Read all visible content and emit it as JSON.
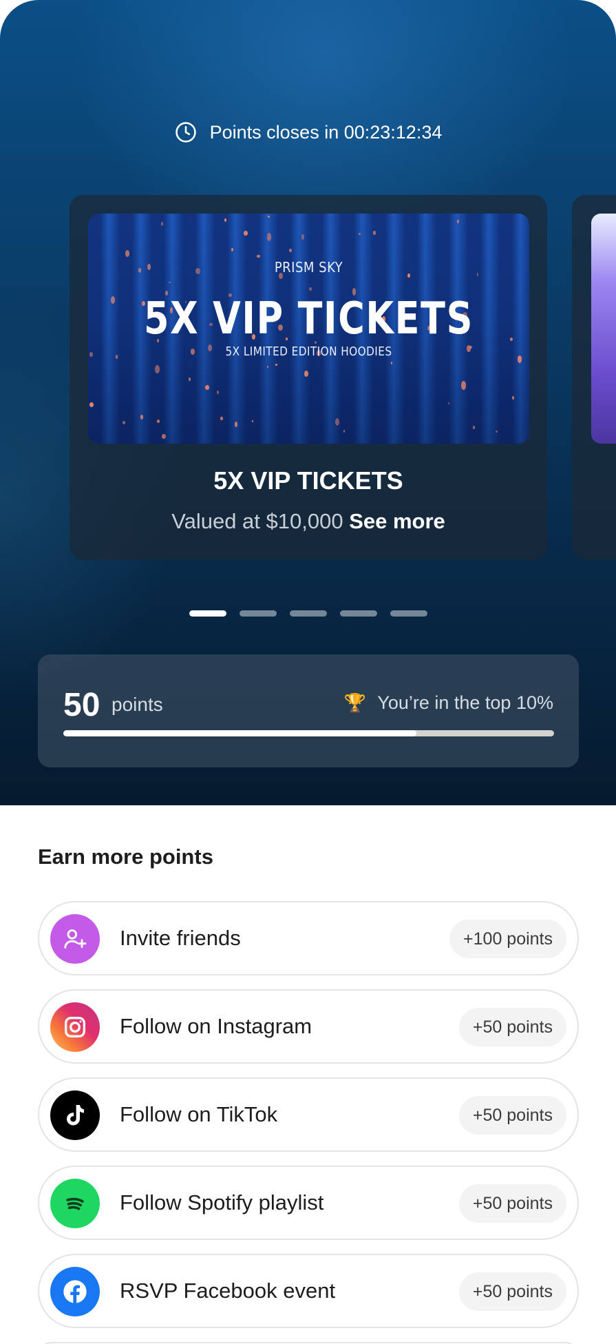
{
  "timer": {
    "text": "Points closes in 00:23:12:34",
    "icon": "clock-icon"
  },
  "prize_card": {
    "image": {
      "brand": "PRISM SKY",
      "title": "5X VIP TICKETS",
      "subtitle": "5X LIMITED EDITION HOODIES"
    },
    "title": "5X VIP TICKETS",
    "value_text": "Valued at $10,000",
    "see_more": "See more"
  },
  "carousel": {
    "total_slides": 5,
    "active_index": 0
  },
  "points": {
    "value": "50",
    "label": "points",
    "rank_text": "You’re in the top 10%",
    "rank_icon": "trophy-icon",
    "progress_fraction": 0.72
  },
  "earn": {
    "title": "Earn more points",
    "tasks": [
      {
        "label": "Invite friends",
        "badge": "+100 points",
        "icon": "add-user-icon",
        "color": "#c45be8"
      },
      {
        "label": "Follow on Instagram",
        "badge": "+50 points",
        "icon": "instagram-icon",
        "color": "#e1306c"
      },
      {
        "label": "Follow on TikTok",
        "badge": "+50 points",
        "icon": "tiktok-icon",
        "color": "#000000"
      },
      {
        "label": "Follow Spotify playlist",
        "badge": "+50 points",
        "icon": "spotify-icon",
        "color": "#1ed760"
      },
      {
        "label": "RSVP Facebook event",
        "badge": "+50 points",
        "icon": "facebook-icon",
        "color": "#1877f2"
      }
    ]
  },
  "colors": {
    "hero_top": "#0b4f86",
    "hero_bottom": "#061a2e",
    "trophy": "#f4b43a"
  }
}
